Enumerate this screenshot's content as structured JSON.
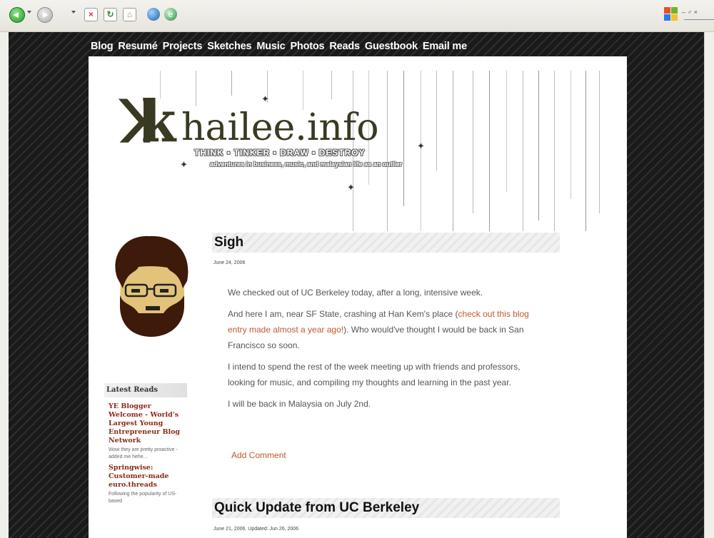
{
  "nav": [
    "Blog",
    "Resumé",
    "Projects",
    "Sketches",
    "Music",
    "Photos",
    "Reads",
    "Guestbook",
    "Email me"
  ],
  "header": {
    "site_name": "hailee.info",
    "logo_mark": "ꓘk",
    "tagline": "THINK • TINKER • DRAW • DESTROY",
    "subtitle": "adventures in business, music, and malaysian life as an outlier"
  },
  "sidebar": {
    "title": "Latest Reads",
    "items": [
      {
        "title": "YE Blogger Welcome - World's Largest Young Entrepreneur Blog Network",
        "desc": "Wow they are pretty proactive - added me hehe..."
      },
      {
        "title": "Springwise: Customer-made euro.threads",
        "desc": "Following the popularity of US-based"
      }
    ]
  },
  "posts": [
    {
      "title": "Sigh",
      "date": "June 24, 2006",
      "p1": "We checked out of UC Berkeley today, after a long, intensive week.",
      "p2_before": "And here I am, near SF State, crashing at Han Kem's place (",
      "p2_link": "check out this blog entry made almost a year ago!",
      "p2_after": "). Who would've thought I would be back in San Francisco so soon.",
      "p3": "I intend to spend the rest of the week meeting up with friends and professors, looking for music, and compiling my thoughts and learning in the past year.",
      "p4": "I will be back in Malaysia on July 2nd.",
      "comment": "Add Comment"
    },
    {
      "title": "Quick Update from UC Berkeley",
      "date": "June 21, 2006. Updated: Jun 26, 2006"
    }
  ],
  "toolbar": {
    "icons": [
      "back-icon",
      "forward-icon",
      "stop-icon",
      "refresh-icon",
      "home-icon",
      "globe-icon",
      "media-icon",
      "windows-logo-icon"
    ],
    "window_controls": "– ♂ ×"
  },
  "colors": {
    "link": "#c05a2a",
    "sidebar_link": "#8a2a16",
    "page_bg": "#1a1a1a"
  }
}
